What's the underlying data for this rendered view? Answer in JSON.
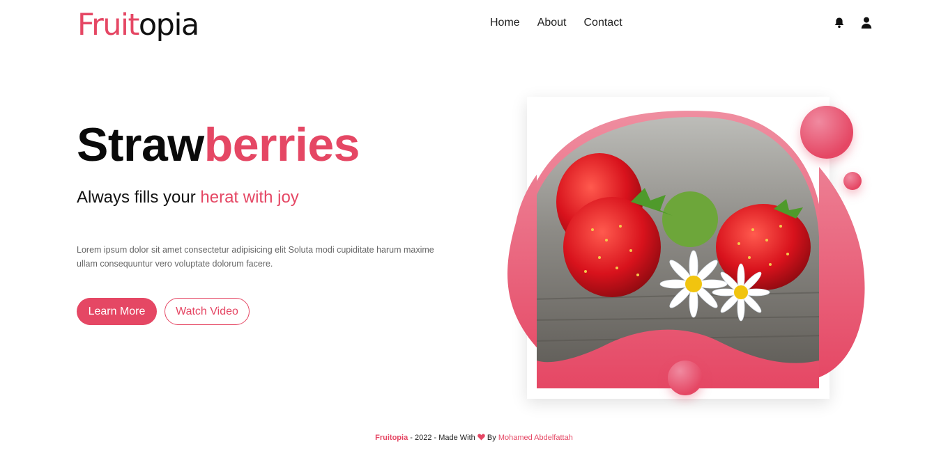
{
  "header": {
    "logo_accent": "Fruit",
    "logo_rest": "opia",
    "nav": [
      "Home",
      "About",
      "Contact"
    ],
    "icons": [
      "bell-icon",
      "user-icon"
    ]
  },
  "hero": {
    "title_dark": "Straw",
    "title_pink": "berries",
    "subtitle_dark": "Always fills your",
    "subtitle_pink": "herat with joy",
    "description": "Lorem ipsum dolor sit amet consectetur adipisicing elit Soluta modi cupiditate harum maxime ullam consequuntur vero voluptate dolorum facere.",
    "learn_more": "Learn More",
    "watch_video": "Watch Video"
  },
  "footer": {
    "brand": "Fruitopia",
    "text": " - 2022 - Made With ",
    "by": " By ",
    "author": "Mohamed Abdelfattah"
  },
  "colors": {
    "accent": "#e54764",
    "text": "#111111",
    "muted": "#666666"
  }
}
